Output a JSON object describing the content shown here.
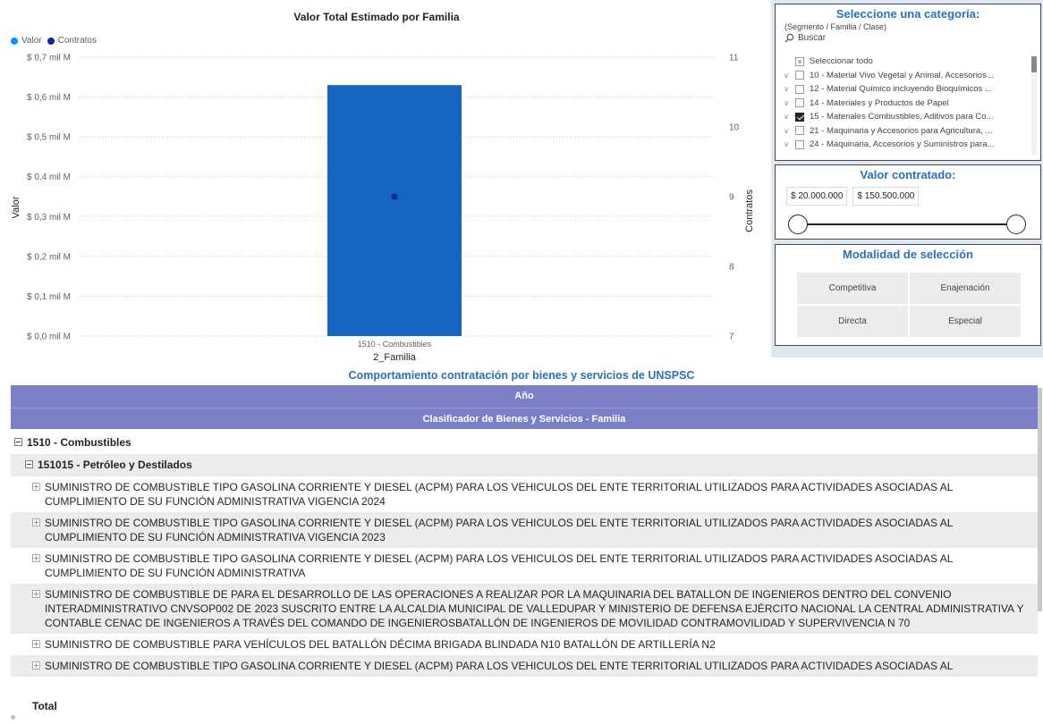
{
  "chart": {
    "title": "Valor Total Estimado por Familia",
    "legend": [
      {
        "label": "Valor",
        "color": "#118dff"
      },
      {
        "label": "Contratos",
        "color": "#12239e"
      }
    ],
    "ylabel_left": "Valor",
    "ylabel_right": "Contratos",
    "xlabel": "2_Familia"
  },
  "chart_data": {
    "type": "bar",
    "title": "Valor Total Estimado por Familia",
    "xlabel": "2_Familia",
    "ylabel": "Valor",
    "y2label": "Contratos",
    "categories": [
      "1510 - Combustibles"
    ],
    "series": [
      {
        "name": "Valor",
        "type": "bar",
        "axis": "left",
        "values": [
          0.63
        ],
        "color": "#1565c0"
      },
      {
        "name": "Contratos",
        "type": "point",
        "axis": "right",
        "values": [
          9
        ],
        "color": "#12239e"
      }
    ],
    "ylim": [
      0,
      0.7
    ],
    "y2lim": [
      7,
      11
    ],
    "yticks": [
      "$ 0,0 mil M",
      "$ 0,1 mil M",
      "$ 0,2 mil M",
      "$ 0,3 mil M",
      "$ 0,4 mil M",
      "$ 0,5 mil M",
      "$ 0,6 mil M",
      "$ 0,7 mil M"
    ],
    "y2ticks": [
      "7",
      "8",
      "9",
      "10",
      "11"
    ],
    "grid": true,
    "legend_position": "top-left"
  },
  "category_slicer": {
    "title": "Seleccione una categoría:",
    "subtitle": "(Segmento / Familia / Clase)",
    "search_placeholder": "Buscar",
    "items": [
      {
        "label": "Seleccionar todo",
        "state": "partial",
        "expandable": false
      },
      {
        "label": "10 - Material Vivo Vegetal y Animal, Accesorios...",
        "state": "unchecked",
        "expandable": true
      },
      {
        "label": "12 - Material Químico incluyendo Bioquímicos ...",
        "state": "unchecked",
        "expandable": true
      },
      {
        "label": "14 - Materiales y Productos de Papel",
        "state": "unchecked",
        "expandable": true
      },
      {
        "label": "15 - Materiales Combustibles, Aditivos para Co...",
        "state": "checked",
        "expandable": true
      },
      {
        "label": "21 - Maquinaria y Accesorios para Agricultura, ...",
        "state": "unchecked",
        "expandable": true
      },
      {
        "label": "24 - Maquinaria, Accesorios y Suministros para...",
        "state": "unchecked",
        "expandable": true
      }
    ]
  },
  "value_slicer": {
    "title": "Valor contratado:",
    "min": "$ 20.000.000",
    "max": "$ 150.500.000"
  },
  "modality_slicer": {
    "title": "Modalidad de selección",
    "options": [
      "Competitiva",
      "Enajenación",
      "Directa",
      "Especial"
    ]
  },
  "matrix": {
    "title": "Comportamiento contratación por bienes y servicios de UNSPSC",
    "header_year": "Año",
    "header_class": "Clasificador de Bienes y Servicios - Familia",
    "level1": "1510 - Combustibles",
    "level2": "151015 - Petróleo y Destilados",
    "rows": [
      "SUMINISTRO DE COMBUSTIBLE TIPO GASOLINA CORRIENTE Y DIESEL (ACPM) PARA LOS VEHICULOS DEL ENTE TERRITORIAL UTILIZADOS PARA ACTIVIDADES ASOCIADAS AL CUMPLIMIENTO DE SU FUNCIÓN ADMINISTRATIVA VIGENCIA 2024",
      "SUMINISTRO DE COMBUSTIBLE TIPO GASOLINA CORRIENTE Y DIESEL (ACPM) PARA LOS VEHICULOS DEL ENTE TERRITORIAL UTILIZADOS PARA ACTIVIDADES ASOCIADAS AL CUMPLIMIENTO DE SU FUNCIÓN ADMINISTRATIVA VIGENCIA 2023",
      "SUMINISTRO DE COMBUSTIBLE TIPO GASOLINA CORRIENTE Y DIESEL (ACPM) PARA LOS VEHICULOS DEL ENTE TERRITORIAL UTILIZADOS PARA ACTIVIDADES ASOCIADAS AL CUMPLIMIENTO DE SU FUNCIÓN ADMINISTRATIVA",
      "SUMINISTRO DE COMBUSTIBLE DE PARA EL DESARROLLO DE LAS OPERACIONES A REALIZAR POR LA MAQUINARIA DEL BATALLON DE INGENIEROS DENTRO DEL CONVENIO INTERADMINISTRATIVO CNVSOP002 DE 2023 SUSCRITO ENTRE LA ALCALDIA MUNICIPAL DE VALLEDUPAR Y MINISTERIO DE DEFENSA EJÉRCITO NACIONAL LA CENTRAL ADMINISTRATIVA Y CONTABLE CENAC DE INGENIEROS A TRAVÉS DEL COMANDO DE INGENIEROSBATALLÓN DE INGENIEROS DE MOVILIDAD CONTRAMOVILIDAD Y SUPERVIVENCIA N 70",
      "SUMINISTRO DE COMBUSTIBLE PARA VEHÍCULOS DEL BATALLÓN DÉCIMA BRIGADA BLINDADA N10 BATALLÓN DE ARTILLERÍA N2",
      "SUMINISTRO DE COMBUSTIBLE TIPO GASOLINA CORRIENTE Y DIESEL (ACPM) PARA LOS VEHICULOS DEL ENTE TERRITORIAL UTILIZADOS PARA ACTIVIDADES ASOCIADAS AL"
    ],
    "total_label": "Total"
  }
}
